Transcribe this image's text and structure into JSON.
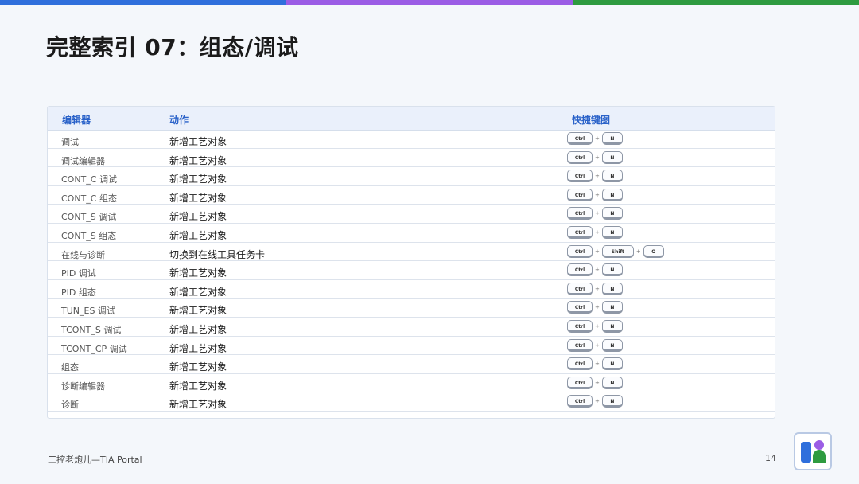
{
  "colors": {
    "bar_blue": "#2f6fdc",
    "bar_purple": "#9b5de5",
    "bar_green": "#2e9b40",
    "header_text": "#2a62c9"
  },
  "title": "完整索引 07：组态/调试",
  "table": {
    "headers": [
      "编辑器",
      "动作",
      "快捷键图"
    ],
    "rows": [
      {
        "editor": "调试",
        "action": "新增工艺对象",
        "keys": [
          "Ctrl",
          "N"
        ]
      },
      {
        "editor": "调试编辑器",
        "action": "新增工艺对象",
        "keys": [
          "Ctrl",
          "N"
        ]
      },
      {
        "editor": "CONT_C 调试",
        "action": "新增工艺对象",
        "keys": [
          "Ctrl",
          "N"
        ]
      },
      {
        "editor": "CONT_C 组态",
        "action": "新增工艺对象",
        "keys": [
          "Ctrl",
          "N"
        ]
      },
      {
        "editor": "CONT_S 调试",
        "action": "新增工艺对象",
        "keys": [
          "Ctrl",
          "N"
        ]
      },
      {
        "editor": "CONT_S 组态",
        "action": "新增工艺对象",
        "keys": [
          "Ctrl",
          "N"
        ]
      },
      {
        "editor": "在线与诊断",
        "action": "切换到在线工具任务卡",
        "keys": [
          "Ctrl",
          "Shift",
          "O"
        ]
      },
      {
        "editor": "PID 调试",
        "action": "新增工艺对象",
        "keys": [
          "Ctrl",
          "N"
        ]
      },
      {
        "editor": "PID 组态",
        "action": "新增工艺对象",
        "keys": [
          "Ctrl",
          "N"
        ]
      },
      {
        "editor": "TUN_ES 调试",
        "action": "新增工艺对象",
        "keys": [
          "Ctrl",
          "N"
        ]
      },
      {
        "editor": "TCONT_S 调试",
        "action": "新增工艺对象",
        "keys": [
          "Ctrl",
          "N"
        ]
      },
      {
        "editor": "TCONT_CP 调试",
        "action": "新增工艺对象",
        "keys": [
          "Ctrl",
          "N"
        ]
      },
      {
        "editor": "组态",
        "action": "新增工艺对象",
        "keys": [
          "Ctrl",
          "N"
        ]
      },
      {
        "editor": "诊断编辑器",
        "action": "新增工艺对象",
        "keys": [
          "Ctrl",
          "N"
        ]
      },
      {
        "editor": "诊断",
        "action": "新增工艺对象",
        "keys": [
          "Ctrl",
          "N"
        ]
      }
    ]
  },
  "footer": {
    "left": "工控老炮儿—TIA Portal",
    "page_number": "14"
  },
  "logo": {
    "icon": "app-logo-icon"
  }
}
